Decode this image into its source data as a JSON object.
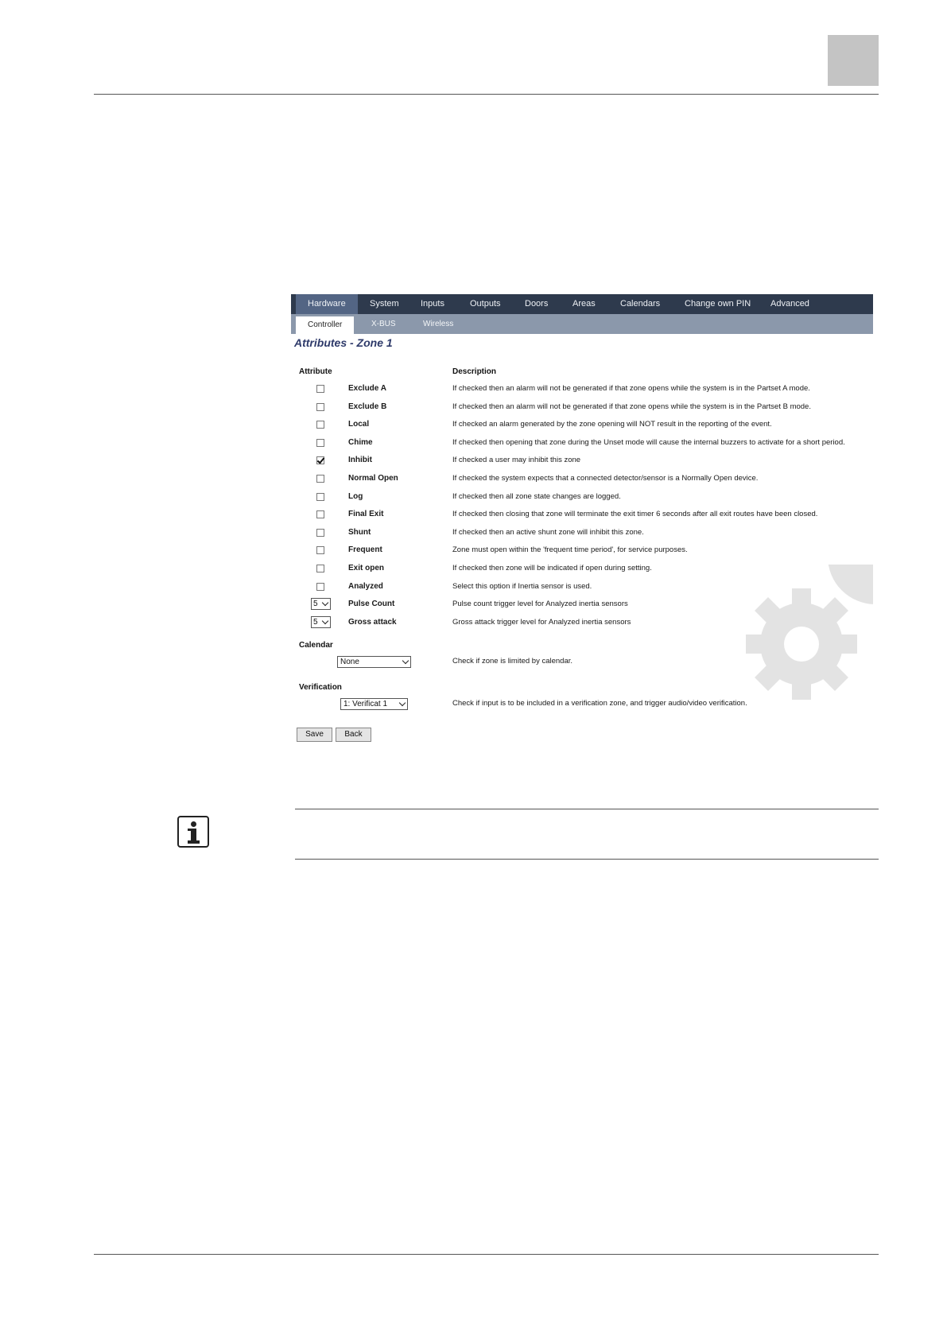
{
  "nav": {
    "tabs": [
      "Hardware",
      "System",
      "Inputs",
      "Outputs",
      "Doors",
      "Areas",
      "Calendars",
      "Change own PIN",
      "Advanced"
    ],
    "active_tab": "Hardware",
    "subtabs": [
      "Controller",
      "X-BUS",
      "Wireless"
    ],
    "active_subtab": "Controller"
  },
  "page": {
    "title": "Attributes - Zone 1",
    "col_attribute": "Attribute",
    "col_description": "Description"
  },
  "attributes": [
    {
      "name": "Exclude A",
      "checked": false,
      "desc": "If checked then an alarm will not be generated if that zone opens while the system is in the Partset A mode."
    },
    {
      "name": "Exclude B",
      "checked": false,
      "desc": "If checked then an alarm will not be generated if that zone opens while the system is in the Partset B mode."
    },
    {
      "name": "Local",
      "checked": false,
      "desc": "If checked an alarm generated by the zone opening will NOT result in the reporting of the event."
    },
    {
      "name": "Chime",
      "checked": false,
      "desc": "If checked then opening that zone during the Unset mode will cause the internal buzzers to activate for a short period."
    },
    {
      "name": "Inhibit",
      "checked": true,
      "desc": "If checked a user may inhibit this zone"
    },
    {
      "name": "Normal Open",
      "checked": false,
      "desc": "If checked the system expects that a connected detector/sensor is a Normally Open device."
    },
    {
      "name": "Log",
      "checked": false,
      "desc": "If checked then all zone state changes are logged."
    },
    {
      "name": "Final Exit",
      "checked": false,
      "desc": "If checked then closing that zone will terminate the exit timer 6 seconds after all exit routes have been closed."
    },
    {
      "name": "Shunt",
      "checked": false,
      "desc": "If checked then an active shunt zone will inhibit this zone."
    },
    {
      "name": "Frequent",
      "checked": false,
      "desc": "Zone must open within the 'frequent time period', for service purposes."
    },
    {
      "name": "Exit open",
      "checked": false,
      "desc": "If checked then zone will be indicated if open during setting."
    },
    {
      "name": "Analyzed",
      "checked": false,
      "desc": "Select this option if Inertia sensor is used."
    }
  ],
  "level_attributes": [
    {
      "name": "Pulse Count",
      "value": "5",
      "desc": "Pulse count trigger level for Analyzed inertia sensors"
    },
    {
      "name": "Gross attack",
      "value": "5",
      "desc": "Gross attack trigger level for Analyzed inertia sensors"
    }
  ],
  "calendar": {
    "label": "Calendar",
    "value": "None",
    "desc": "Check if zone is limited by calendar."
  },
  "verification": {
    "label": "Verification",
    "value": "1: Verificat 1",
    "desc": "Check if input is to be included in a verification zone, and trigger audio/video verification."
  },
  "buttons": {
    "save": "Save",
    "back": "Back"
  },
  "colors": {
    "nav_bg": "#2e3a4d",
    "subnav_bg": "#8b98ab",
    "title": "#2e3a6a"
  }
}
